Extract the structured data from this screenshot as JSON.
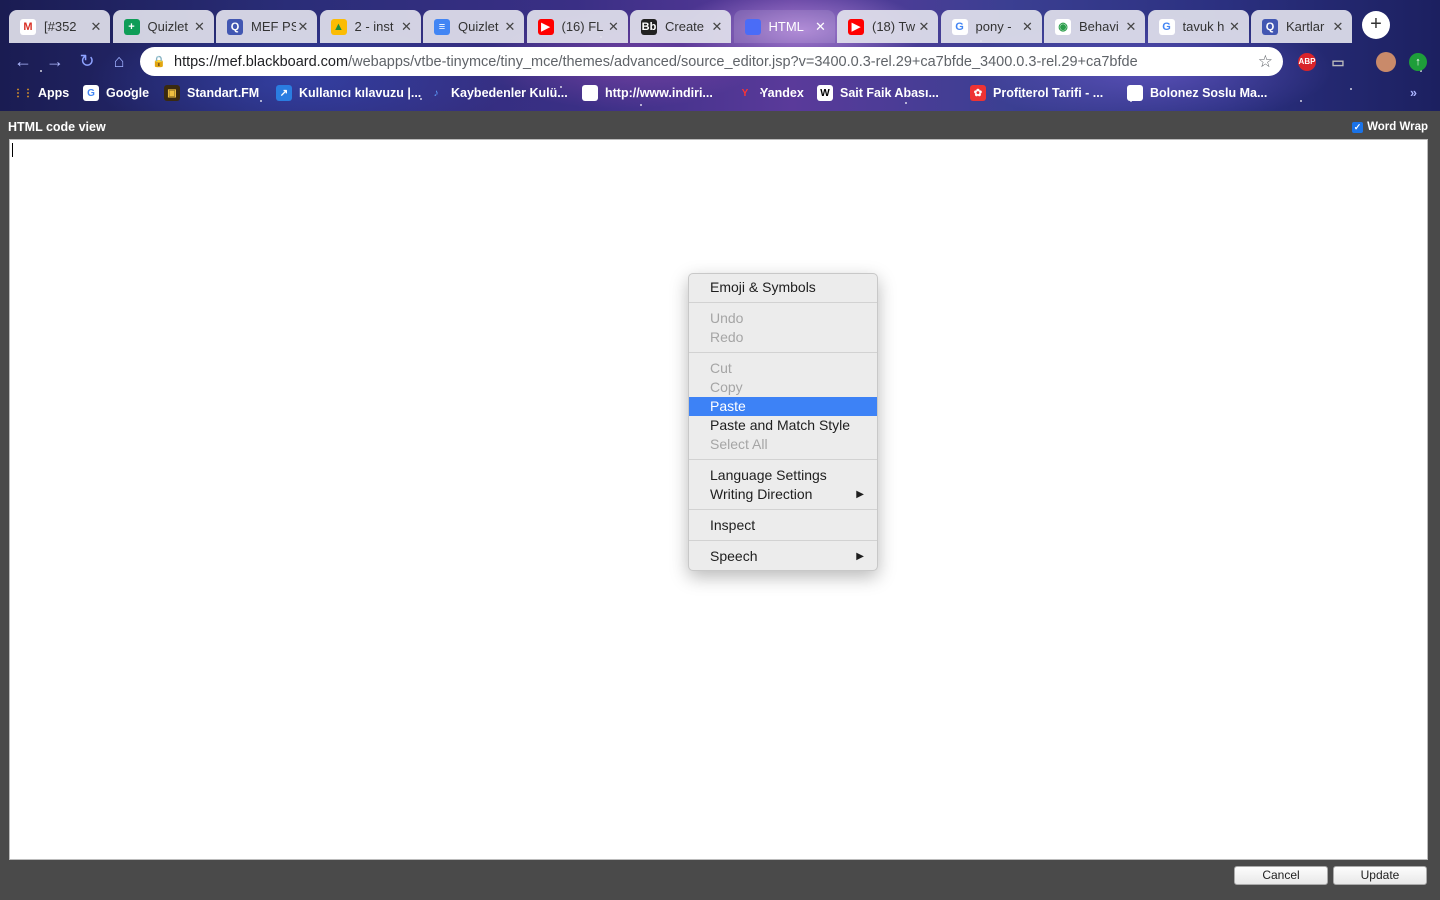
{
  "tabs": [
    {
      "title": "[#352",
      "favicon": "gmail-icon",
      "active": false
    },
    {
      "title": "Quizlet",
      "favicon": "sheets-icon",
      "active": false
    },
    {
      "title": "MEF PS",
      "favicon": "quizlet-icon",
      "active": false
    },
    {
      "title": "2 - inst",
      "favicon": "drive-icon",
      "active": false
    },
    {
      "title": "Quizlet",
      "favicon": "docs-icon",
      "active": false
    },
    {
      "title": "(16) FL",
      "favicon": "youtube-icon",
      "active": false
    },
    {
      "title": "Create",
      "favicon": "blackboard-icon",
      "active": false
    },
    {
      "title": "HTML",
      "favicon": "page-icon",
      "active": true
    },
    {
      "title": "(18) Tw",
      "favicon": "youtube-icon",
      "active": false
    },
    {
      "title": "pony -",
      "favicon": "google-icon",
      "active": false
    },
    {
      "title": "Behavi",
      "favicon": "chrome-icon",
      "active": false
    },
    {
      "title": "tavuk h",
      "favicon": "google-icon",
      "active": false
    },
    {
      "title": "Kartlar",
      "favicon": "quizlet-icon",
      "active": false
    }
  ],
  "new_tab_label": "+",
  "omnibox": {
    "host": "https://mef.blackboard.com",
    "path": "/webapps/vtbe-tinymce/tiny_mce/themes/advanced/source_editor.jsp?v=3400.0.3-rel.29+ca7bfde_3400.0.3-rel.29+ca7bfde"
  },
  "extensions": {
    "abp": "ABP"
  },
  "bookmarks": [
    {
      "label": "Apps",
      "icon": "apps-grid-icon"
    },
    {
      "label": "Google",
      "icon": "google-icon"
    },
    {
      "label": "Standart.FM",
      "icon": "radio-icon"
    },
    {
      "label": "Kullanıcı kılavuzu |...",
      "icon": "link-icon"
    },
    {
      "label": "Kaybedenler Kulü...",
      "icon": "music-icon"
    },
    {
      "label": "http://www.indiri...",
      "icon": "page-icon"
    },
    {
      "label": "Yandex",
      "icon": "yandex-icon"
    },
    {
      "label": "Sait Faik Abası...",
      "icon": "wikipedia-icon"
    },
    {
      "label": "Profiterol Tarifi - ...",
      "icon": "recipe-icon"
    },
    {
      "label": "Bolonez Soslu Ma...",
      "icon": "page-icon"
    }
  ],
  "editor": {
    "header": "HTML code view",
    "word_wrap_label": "Word Wrap",
    "word_wrap_checked": true,
    "content": ""
  },
  "buttons": {
    "cancel": "Cancel",
    "update": "Update"
  },
  "context_menu": {
    "groups": [
      [
        {
          "label": "Emoji & Symbols",
          "enabled": true
        }
      ],
      [
        {
          "label": "Undo",
          "enabled": false
        },
        {
          "label": "Redo",
          "enabled": false
        }
      ],
      [
        {
          "label": "Cut",
          "enabled": false
        },
        {
          "label": "Copy",
          "enabled": false
        },
        {
          "label": "Paste",
          "enabled": true,
          "highlighted": true
        },
        {
          "label": "Paste and Match Style",
          "enabled": true
        },
        {
          "label": "Select All",
          "enabled": false
        }
      ],
      [
        {
          "label": "Language Settings",
          "enabled": true
        },
        {
          "label": "Writing Direction",
          "enabled": true,
          "submenu": true
        }
      ],
      [
        {
          "label": "Inspect",
          "enabled": true
        }
      ],
      [
        {
          "label": "Speech",
          "enabled": true,
          "submenu": true
        }
      ]
    ]
  },
  "colors": {
    "highlight": "#3d82f6",
    "page_bg": "#4a4a4a",
    "accent_check": "#1a73e8"
  }
}
